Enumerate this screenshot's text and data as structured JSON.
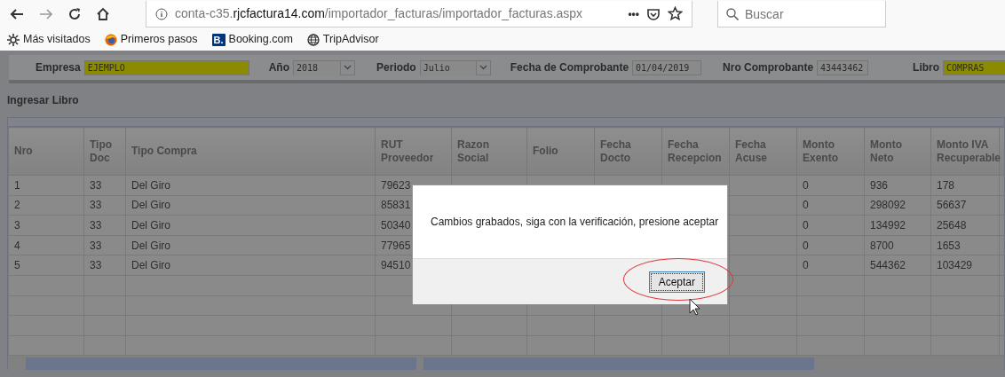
{
  "browser": {
    "url": {
      "subdomain": "conta-c35.",
      "domain": "rjcfactura14.com",
      "path": "/importador_facturas/importador_facturas.aspx"
    },
    "page_actions": "•••",
    "search": {
      "placeholder": "Buscar"
    },
    "bookmarks": [
      {
        "label": "Más visitados",
        "kind": "gear"
      },
      {
        "label": "Primeros pasos",
        "kind": "firefox"
      },
      {
        "label": "Booking.com",
        "kind": "booking",
        "logo_text": "B."
      },
      {
        "label": "TripAdvisor",
        "kind": "globe"
      }
    ]
  },
  "header_fields": [
    {
      "label": "Empresa",
      "value": "EJEMPLO",
      "kind": "text",
      "highlighted": true
    },
    {
      "label": "Año",
      "value": "2018",
      "kind": "select",
      "highlighted": false
    },
    {
      "label": "Periodo",
      "value": "Julio",
      "kind": "select",
      "highlighted": false
    },
    {
      "label": "Fecha de Comprobante",
      "value": "01/04/2019",
      "kind": "text",
      "highlighted": false
    },
    {
      "label": "Nro Comprobante",
      "value": "43443462",
      "kind": "text",
      "highlighted": false
    },
    {
      "label": "Libro",
      "value": "COMPRAS",
      "kind": "text",
      "highlighted": true
    }
  ],
  "section_title": "Ingresar Libro",
  "table": {
    "columns": [
      "Nro",
      "Tipo Doc",
      "Tipo Compra",
      "RUT Proveedor",
      "Razon Social",
      "Folio",
      "Fecha Docto",
      "Fecha Recepcion",
      "Fecha Acuse",
      "Monto Exento",
      "Monto Neto",
      "Monto IVA Recuperable"
    ],
    "rows": [
      [
        "1",
        "33",
        "Del Giro",
        "79623",
        "",
        "",
        "",
        "",
        "",
        "0",
        "936",
        "178"
      ],
      [
        "2",
        "33",
        "Del Giro",
        "85831",
        "",
        "",
        "",
        "",
        "",
        "0",
        "298092",
        "56637"
      ],
      [
        "3",
        "33",
        "Del Giro",
        "50340",
        "",
        "",
        "",
        "",
        "",
        "0",
        "134992",
        "25648"
      ],
      [
        "4",
        "33",
        "Del Giro",
        "77965",
        "",
        "",
        "",
        "",
        "",
        "0",
        "8700",
        "1653"
      ],
      [
        "5",
        "33",
        "Del Giro",
        "94510",
        "",
        "",
        "",
        "",
        "",
        "0",
        "544362",
        "103429"
      ]
    ]
  },
  "dialog": {
    "message": "Cambios grabados, siga con la verificación, presione aceptar",
    "button": "Aceptar"
  }
}
